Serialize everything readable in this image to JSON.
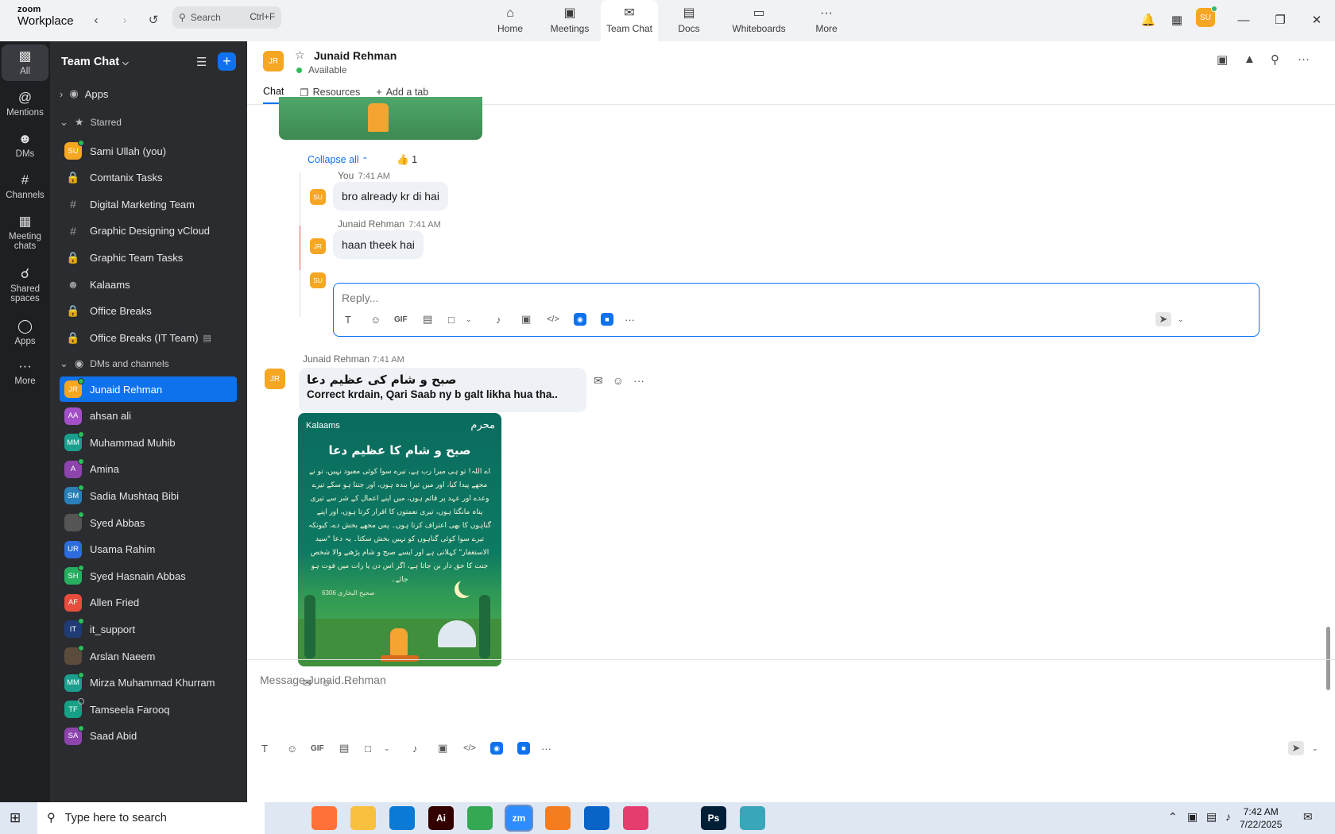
{
  "app": {
    "brand_top": "zoom",
    "brand_bottom": "Workplace"
  },
  "top_search": {
    "placeholder": "Search",
    "shortcut": "Ctrl+F"
  },
  "nav": [
    {
      "label": "Home",
      "icon": "home-icon"
    },
    {
      "label": "Meetings",
      "icon": "video-camera-icon"
    },
    {
      "label": "Team Chat",
      "icon": "chat-icon"
    },
    {
      "label": "Docs",
      "icon": "document-icon"
    },
    {
      "label": "Whiteboards",
      "icon": "whiteboard-icon"
    },
    {
      "label": "More",
      "icon": "more-dots-icon"
    }
  ],
  "user_avatar": "SU",
  "rail": [
    {
      "label": "All",
      "icon": "chat-bubble-icon"
    },
    {
      "label": "Mentions",
      "icon": "at-icon"
    },
    {
      "label": "DMs",
      "icon": "people-icon"
    },
    {
      "label": "Channels",
      "icon": "hash-icon"
    },
    {
      "label": "Meeting chats",
      "icon": "calendar-icon"
    },
    {
      "label": "Shared spaces",
      "icon": "shared-icon"
    },
    {
      "label": "Apps",
      "icon": "apps-icon"
    },
    {
      "label": "More",
      "icon": "more-dots-icon"
    }
  ],
  "sidebar": {
    "title": "Team Chat",
    "sections": {
      "apps": "Apps",
      "starred": "Starred",
      "dms": "DMs and channels"
    },
    "starred": [
      {
        "label": "Sami Ullah (you)",
        "kind": "avatar",
        "initials": "SU",
        "color": "#f5a623",
        "status": "online"
      },
      {
        "label": "Comtanix Tasks",
        "kind": "lock"
      },
      {
        "label": "Digital Marketing Team",
        "kind": "hash"
      },
      {
        "label": "Graphic Designing vCloud",
        "kind": "hash"
      },
      {
        "label": "Graphic Team Tasks",
        "kind": "lock"
      },
      {
        "label": "Kalaams",
        "kind": "people"
      },
      {
        "label": "Office Breaks",
        "kind": "lock"
      },
      {
        "label": "Office Breaks (IT Team)",
        "kind": "lock"
      }
    ],
    "dms": [
      {
        "label": "Junaid Rehman",
        "initials": "JR",
        "color": "#f5a623",
        "status": "online",
        "active": true
      },
      {
        "label": "ahsan ali",
        "initials": "AA",
        "color": "#a34fc7",
        "status": "none"
      },
      {
        "label": "Muhammad Muhib",
        "initials": "MM",
        "color": "#1a9f8f",
        "status": "online"
      },
      {
        "label": "Amina",
        "initials": "A",
        "color": "#8e44ad",
        "status": "online"
      },
      {
        "label": "Sadia Mushtaq Bibi",
        "initials": "SM",
        "color": "#2980b9",
        "status": "online"
      },
      {
        "label": "Syed Abbas",
        "initials": "",
        "color": "#555555",
        "status": "online"
      },
      {
        "label": "Usama Rahim",
        "initials": "UR",
        "color": "#2d6cdf",
        "status": "none"
      },
      {
        "label": "Syed Hasnain Abbas",
        "initials": "SH",
        "color": "#27ae60",
        "status": "online"
      },
      {
        "label": "Allen Fried",
        "initials": "AF",
        "color": "#e74c3c",
        "status": "none"
      },
      {
        "label": "it_support",
        "initials": "IT",
        "color": "#1f3b73",
        "status": "online"
      },
      {
        "label": "Arslan Naeem",
        "initials": "",
        "color": "#5a4b3c",
        "status": "online"
      },
      {
        "label": "Mirza Muhammad Khurram",
        "initials": "MM",
        "color": "#1a9f8f",
        "status": "online"
      },
      {
        "label": "Tamseela Farooq",
        "initials": "TF",
        "color": "#16a085",
        "status": "offline"
      },
      {
        "label": "Saad Abid",
        "initials": "SA",
        "color": "#8e44ad",
        "status": "online"
      }
    ]
  },
  "chat": {
    "header": {
      "initials": "JR",
      "name": "Junaid Rehman",
      "status": "Available"
    },
    "tabs": [
      "Chat",
      "Resources",
      "Add a tab"
    ],
    "thread": {
      "collapse": "Collapse all",
      "reaction_count": "1",
      "replies": [
        {
          "initials": "SU",
          "author": "You",
          "time": "7:41 AM",
          "text": "bro already kr di hai"
        },
        {
          "initials": "JR",
          "author": "Junaid Rehman",
          "time": "7:41 AM",
          "text": "haan theek hai"
        }
      ],
      "reply_initials": "SU",
      "reply_placeholder": "Reply..."
    },
    "message": {
      "initials": "JR",
      "author": "Junaid Rehman",
      "time": "7:41 AM",
      "line1": "صبح و شام کی عظیم دعا",
      "line2": "Correct krdain, Qari Saab ny b galt likha hua tha.."
    },
    "poster": {
      "brand": "Kalaams",
      "month": "محرم",
      "title": "صبح و شام کا عظیم دعا",
      "body": "اے اللہ! تو ہی میرا رب ہے، تیرے سوا کوئی معبود نہیں، تو نے مجھے پیدا کیا، اور میں تیرا بندہ ہوں، اور جتنا ہو سکے تیرے وعدے اور عہد پر قائم ہوں، میں اپنے اعمال کے شر سے تیری پناہ مانگتا ہوں، تیری نعمتوں کا اقرار کرتا ہوں، اور اپنے گناہوں کا بھی اعتراف کرتا ہوں۔ پس مجھے بخش دے، کیونکہ تیرے سوا کوئی گناہوں کو نہیں بخش سکتا۔ یہ دعا \"سید الاستغفار\" کہلاتی ہے اور ایسے صبح و شام پڑھنے والا شخص جنت کا حق دار بن جاتا ہے، اگر اس دن یا رات میں فوت ہو جائے۔",
      "reference": "صحیح البخاری 6306"
    },
    "composer_placeholder": "Message Junaid Rehman"
  },
  "taskbar": {
    "search_placeholder": "Type here to search",
    "time": "7:42 AM",
    "date": "7/22/2025",
    "apps": [
      {
        "name": "task-view",
        "label": "",
        "color": "#dfe7f3"
      },
      {
        "name": "firefox",
        "label": "",
        "color": "#ff7139"
      },
      {
        "name": "file-explorer",
        "label": "",
        "color": "#f8c03f"
      },
      {
        "name": "vscode",
        "label": "",
        "color": "#0a7ad4"
      },
      {
        "name": "illustrator",
        "label": "Ai",
        "color": "#330000"
      },
      {
        "name": "chrome",
        "label": "",
        "color": "#34a853"
      },
      {
        "name": "zoom",
        "label": "zm",
        "color": "#2d8cff"
      },
      {
        "name": "app-orange",
        "label": "",
        "color": "#f57c1f"
      },
      {
        "name": "outlook",
        "label": "",
        "color": "#0a64c8"
      },
      {
        "name": "creative-cloud",
        "label": "",
        "color": "#e63d6f"
      },
      {
        "name": "pen-tool",
        "label": "",
        "color": "#dfe7f3"
      },
      {
        "name": "photoshop",
        "label": "Ps",
        "color": "#001e36"
      },
      {
        "name": "app-teal",
        "label": "",
        "color": "#3aa6b9"
      }
    ]
  },
  "colors": {
    "accent": "#0e72ed",
    "sidebar_bg": "#2b2c30",
    "rail_bg": "#1e1f22",
    "online": "#2dbd5a"
  }
}
